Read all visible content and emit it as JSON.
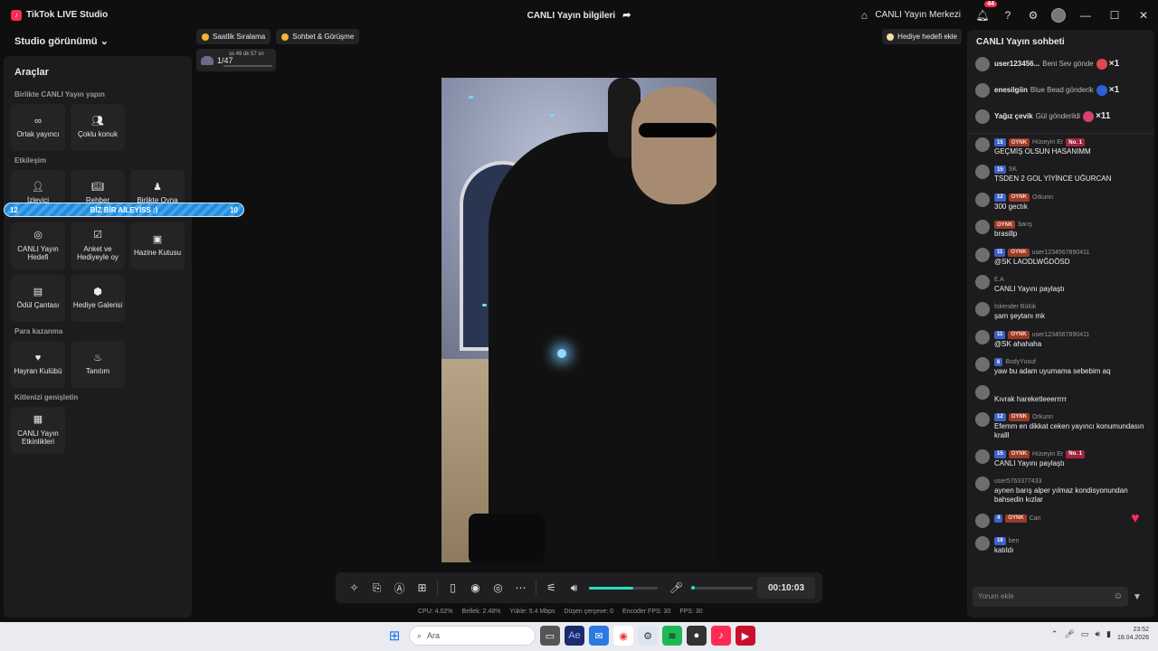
{
  "app": {
    "title": "TikTok LIVE Studio",
    "window_title": "CANLI Yayın bilgileri",
    "hub_label": "CANLI Yayın Merkezi",
    "notification_count": "44"
  },
  "left": {
    "studio_view": "Studio görünümü",
    "tools_title": "Araçlar",
    "sections": {
      "collab": "Birlikte CANLI Yayın yapın",
      "engage": "Etkileşim",
      "monetize": "Para kazanma",
      "expand": "Kitlenizi genişletin"
    },
    "tiles": {
      "cohost": "Ortak yayıncı",
      "multiguest": "Çoklu konuk",
      "viewer": "İzleyici",
      "guide": "Rehber",
      "play_together": "Birlikte Oyna",
      "live_goal": "CANLI Yayın Hedefi",
      "poll": "Anket ve Hediyeyle oy",
      "treasure": "Hazine Kutusu",
      "reward_bag": "Ödül Çantası",
      "gift_gallery": "Hediye Galerisi",
      "fan_club": "Hayran Kulübü",
      "promote": "Tanıtım",
      "live_events": "CANLI Yayın Etkinlikleri"
    },
    "progress_pill": {
      "left": "12",
      "center": "BİZ BİR AİLEYİSS :)",
      "right": "10"
    }
  },
  "top": {
    "chip_ranking": "Saatlik Sıralama",
    "chip_chat": "Sohbet & Görüşme",
    "gift_goal": "Hediye hedefi ekle",
    "mini_count": "1/47",
    "mini_timer": "ss 49 dk 57 sn"
  },
  "controls": {
    "time": "00:10:03",
    "volume_level": 0.65
  },
  "stats": {
    "cpu": "CPU: 4.02%",
    "memory": "Bellek: 2.48%",
    "upload": "Yükle: 5.4 Mbps",
    "dropped": "Düşen çerçeve: 0",
    "encoder_fps": "Encoder FPS: 30",
    "fps": "FPS: 30"
  },
  "chat": {
    "title": "CANLI Yayın sohbeti",
    "gifts": [
      {
        "name": "user123456...",
        "text": "Beni Sev gönde",
        "count": "×1",
        "color": "#e0464e"
      },
      {
        "name": "enesilgiin",
        "text": "Blue Bead gönderik",
        "count": "×1",
        "color": "#2b5fd9"
      },
      {
        "name": "Yağız çevik",
        "text": "Gül gönderildi",
        "count": "×11",
        "color": "#d9406a"
      }
    ],
    "messages": [
      {
        "user": "Hüseyin Er",
        "level": "15",
        "fan": "OYNK",
        "rank": "No. 1",
        "text": "GEÇMİŞ OLSUN HASANIMM"
      },
      {
        "user": "SK",
        "level": "15",
        "fan": "",
        "rank": "",
        "text": "TSDEN 2 GOL YİYİNCE UĞURCAN"
      },
      {
        "user": "Orkunn",
        "level": "12",
        "fan": "OYNK",
        "rank": "",
        "text": "300 gectık"
      },
      {
        "user": "barış",
        "level": "",
        "fan": "OYNK",
        "rank": "",
        "text": "brasillp"
      },
      {
        "user": "user1234567890411",
        "level": "11",
        "fan": "OYNK",
        "rank": "",
        "text": "@SK LAODLWĞDÖSD"
      },
      {
        "user": "Ɛ.A",
        "level": "",
        "fan": "",
        "rank": "",
        "text": "CANLI Yayını paylaştı"
      },
      {
        "user": "İskender Bülük",
        "level": "",
        "fan": "",
        "rank": "",
        "text": "şam şeytanı mk"
      },
      {
        "user": "user1234567890411",
        "level": "11",
        "fan": "OYNK",
        "rank": "",
        "text": "@SK ahahaha"
      },
      {
        "user": "BodyYusuf",
        "level": "6",
        "fan": "",
        "rank": "",
        "text": "yaw bu adam uyumama sebebim aq"
      },
      {
        "user": "",
        "level": "",
        "fan": "",
        "rank": "",
        "text": "Kıvrak hareketleeerrrrr"
      },
      {
        "user": "Orkunn",
        "level": "12",
        "fan": "OYNK",
        "rank": "",
        "text": "Efemm en dikkat ceken yayıncı konumundasın kralll"
      },
      {
        "user": "Hüseyin Er",
        "level": "15",
        "fan": "OYNK",
        "rank": "No. 1",
        "text": "CANLI Yayını paylaştı"
      },
      {
        "user": "user5763377433",
        "level": "",
        "fan": "",
        "rank": "",
        "text": "aynen barış alper yılmaz kondisyonundan bahsedin kızlar"
      },
      {
        "user": "Can",
        "level": "4",
        "fan": "OYNK",
        "rank": "",
        "text": ""
      },
      {
        "user": "ben",
        "level": "18",
        "fan": "",
        "rank": "",
        "text": "katıldı"
      }
    ],
    "input_placeholder": "Yorum ekle"
  },
  "taskbar": {
    "search": "Ara",
    "time": "23:52",
    "date": "18.04.2026"
  }
}
